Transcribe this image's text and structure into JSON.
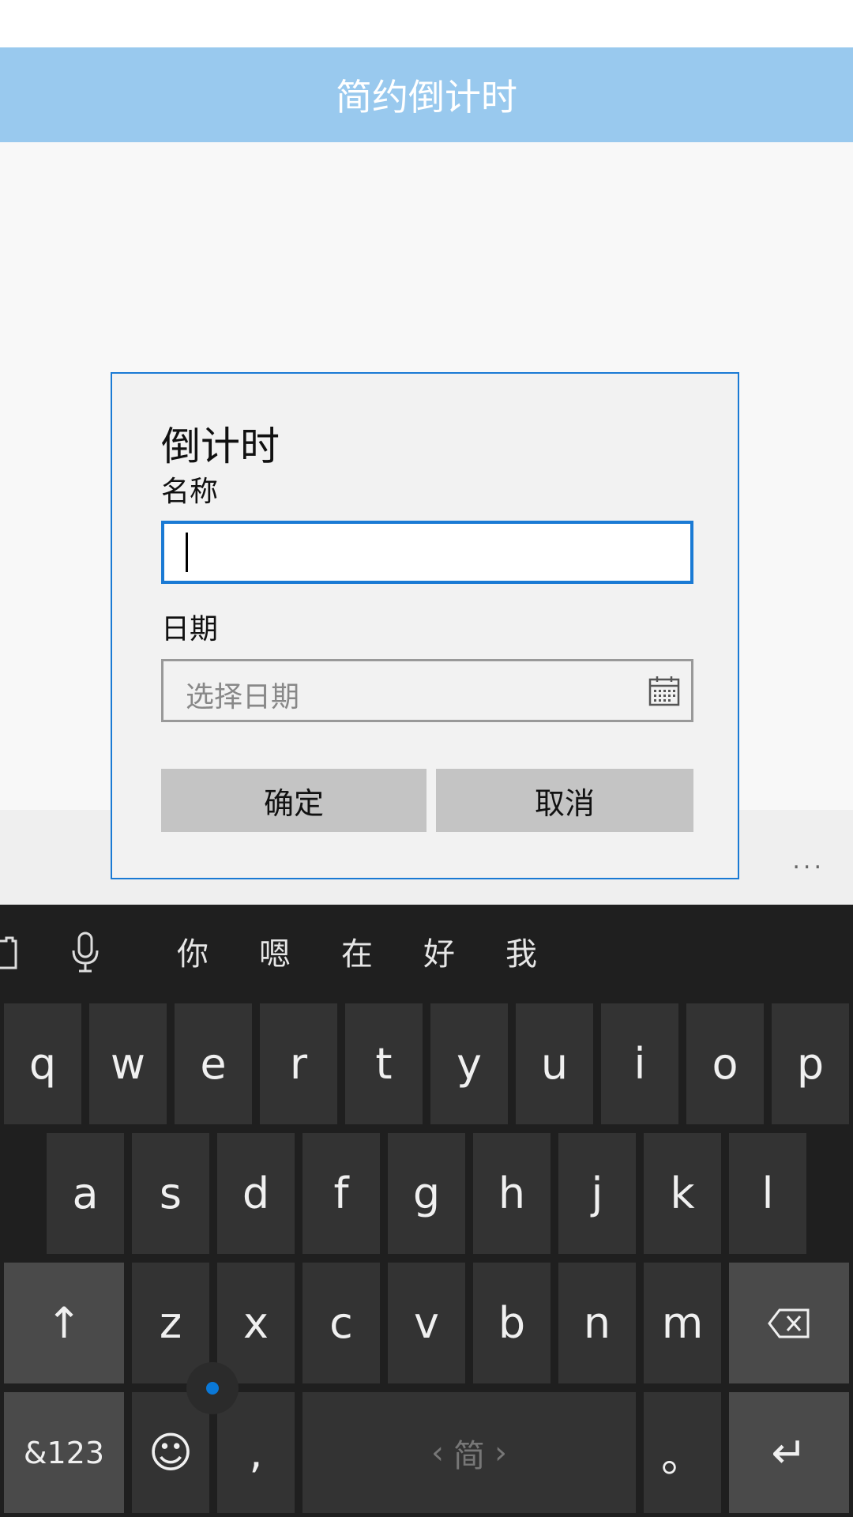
{
  "app": {
    "title": "简约倒计时"
  },
  "dialog": {
    "title": "倒计时",
    "name_label": "名称",
    "name_value": "",
    "date_label": "日期",
    "date_placeholder": "选择日期",
    "confirm_label": "确定",
    "cancel_label": "取消"
  },
  "appbar": {
    "more": "..."
  },
  "keyboard": {
    "candidates": [
      "你",
      "嗯",
      "在",
      "好",
      "我"
    ],
    "row1": [
      "q",
      "w",
      "e",
      "r",
      "t",
      "y",
      "u",
      "i",
      "o",
      "p"
    ],
    "row2": [
      "a",
      "s",
      "d",
      "f",
      "g",
      "h",
      "j",
      "k",
      "l"
    ],
    "row3": [
      "z",
      "x",
      "c",
      "v",
      "b",
      "n",
      "m"
    ],
    "symbols_label": "&123",
    "comma": ",",
    "space_label": "简",
    "space_prev": "‹",
    "space_next": "›",
    "period": "。",
    "shift_icon": "↑",
    "enter_icon": "↵",
    "emoji_icon": "☺"
  },
  "colors": {
    "accent": "#1a7ad4",
    "titlebar": "#99c9ee",
    "keyboard_bg": "#1f1f1f"
  }
}
